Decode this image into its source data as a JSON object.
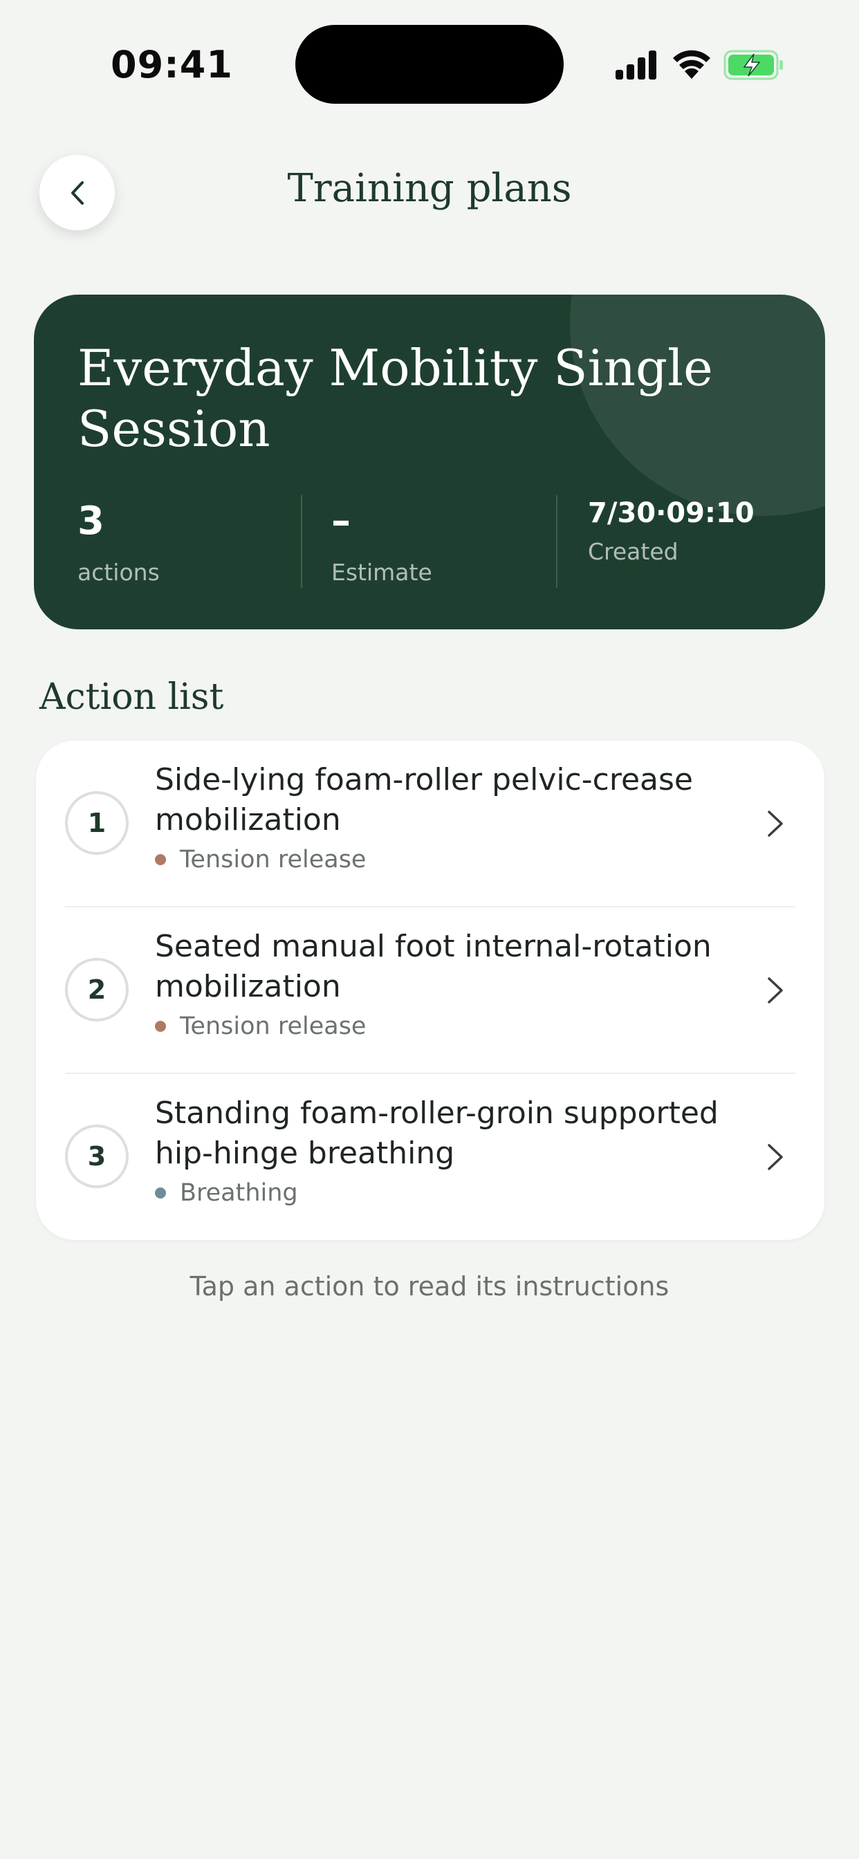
{
  "status_bar": {
    "time": "09:41",
    "icons": [
      "signal-icon",
      "wifi-icon",
      "battery-charging-icon"
    ],
    "battery_color": "#4cd964"
  },
  "header": {
    "back_icon": "chevron-left-icon",
    "title": "Training plans"
  },
  "plan": {
    "title": "Everyday Mobility Single Session",
    "stats": [
      {
        "value": "3",
        "label": "actions"
      },
      {
        "value": "–",
        "label": "Estimate"
      },
      {
        "value": "7/30·09:10",
        "label": "Created"
      }
    ],
    "card_color": "#1e3f2f"
  },
  "action_list": {
    "title": "Action list",
    "items": [
      {
        "number": "1",
        "title": "Side-lying foam-roller pelvic-crease mobilization",
        "tag": "Tension release",
        "tag_color": "#b07a62"
      },
      {
        "number": "2",
        "title": "Seated manual foot internal-rotation mobilization",
        "tag": "Tension release",
        "tag_color": "#b07a62"
      },
      {
        "number": "3",
        "title": "Standing foam-roller-groin supported hip-hinge breathing",
        "tag": "Breathing",
        "tag_color": "#6f8c96"
      }
    ]
  },
  "hint": "Tap an action to read its instructions"
}
